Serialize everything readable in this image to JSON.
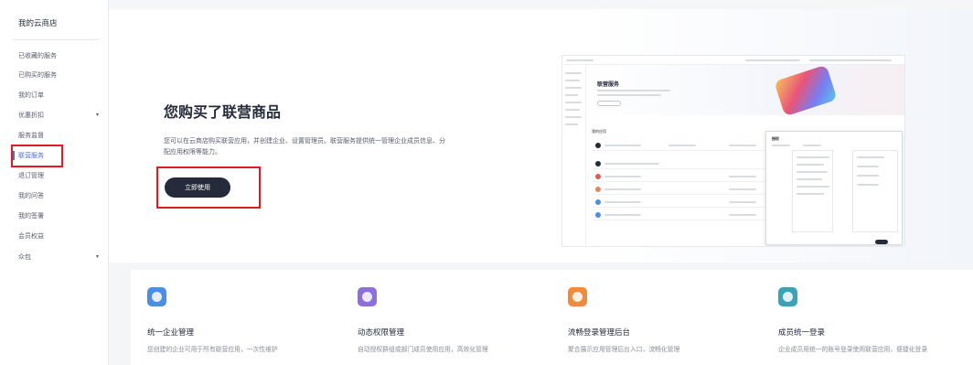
{
  "sidebar": {
    "title": "我的云商店",
    "items": [
      {
        "label": "已收藏的服务",
        "arrow": ""
      },
      {
        "label": "已购买的服务",
        "arrow": ""
      },
      {
        "label": "我的订单",
        "arrow": ""
      },
      {
        "label": "优惠折扣",
        "arrow": "▾"
      },
      {
        "label": "服务监督",
        "arrow": ""
      },
      {
        "label": "联营服务",
        "arrow": ""
      },
      {
        "label": "退订管理",
        "arrow": ""
      },
      {
        "label": "我的问答",
        "arrow": ""
      },
      {
        "label": "我的签署",
        "arrow": ""
      },
      {
        "label": "会员权益",
        "arrow": ""
      },
      {
        "label": "众包",
        "arrow": "▾"
      }
    ],
    "active_index": 5
  },
  "hero": {
    "title": "您购买了联营商品",
    "description": "您可以在云商店购买联营应用，并创建企业、设置管理员。联营服务提供统一管理企业成员信息、分配应用权限等能力。",
    "cta_label": "立即使用",
    "preview": {
      "banner_title": "联营服务",
      "section_title": "我的应用",
      "dialog_title": "授权"
    }
  },
  "features": [
    {
      "title": "统一企业管理",
      "desc": "您创建的企业可用于所有联营应用，一次性维护",
      "icon": "enterprise-icon",
      "color": "#4a8fe0"
    },
    {
      "title": "动态权限管理",
      "desc": "自动授权群组或部门成员使用应用，高效化管理",
      "icon": "permission-icon",
      "color": "#8c6fdd"
    },
    {
      "title": "流畅登录管理后台",
      "desc": "聚合展示应用管理后台入口，流畅化管理",
      "icon": "console-icon",
      "color": "#f08a3c"
    },
    {
      "title": "成员统一登录",
      "desc": "企业成员用统一的账号登录使用联营应用，便捷化登录",
      "icon": "login-icon",
      "color": "#3aa3b8"
    }
  ]
}
